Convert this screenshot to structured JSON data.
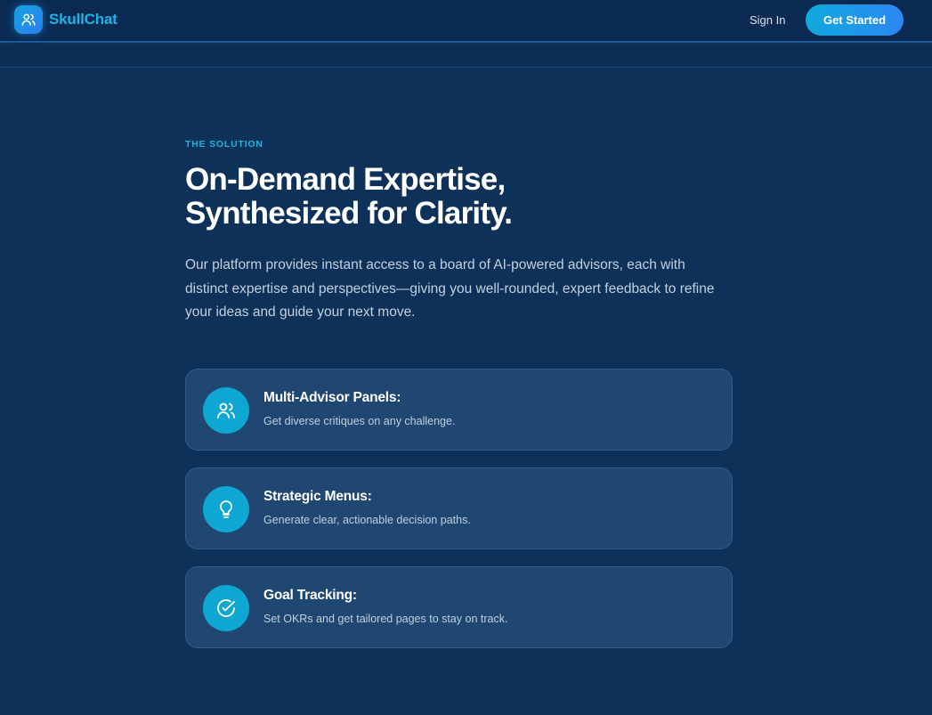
{
  "brand": {
    "name": "SkullChat",
    "icon": "users-icon"
  },
  "nav": {
    "sign_in": "Sign In",
    "get_started": "Get Started"
  },
  "hero": {
    "eyebrow": "THE SOLUTION",
    "headline_line1": "On-Demand Expertise,",
    "headline_line2": "Synthesized for Clarity.",
    "body": "Our platform provides instant access to a board of AI-powered advisors, each with distinct expertise and perspectives—giving you well-rounded, expert feedback to refine your ideas and guide your next move."
  },
  "features": [
    {
      "icon": "users-icon",
      "title": "Multi-Advisor Panels:",
      "description": "Get diverse critiques on any challenge."
    },
    {
      "icon": "lightbulb-icon",
      "title": "Strategic Menus:",
      "description": "Generate clear, actionable decision paths."
    },
    {
      "icon": "check-circle-icon",
      "title": "Goal Tracking:",
      "description": "Set OKRs and get tailored pages to stay on track."
    }
  ],
  "colors": {
    "background": "#0d3159",
    "accent": "#1cb4e6",
    "card": "#1f4771",
    "button_gradient_start": "#0fa9dd",
    "button_gradient_end": "#2c87f2"
  }
}
